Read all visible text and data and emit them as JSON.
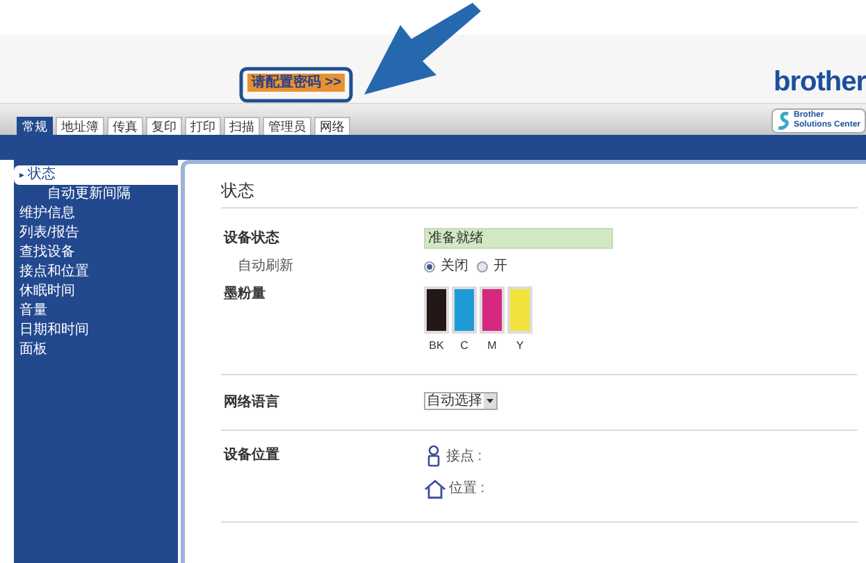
{
  "header": {
    "login_button": "请配置密码 >>",
    "logo": "brother",
    "solutions_button": {
      "line1": "Brother",
      "line2": "Solutions Center"
    }
  },
  "tabs": [
    {
      "label": "常规",
      "selected": true
    },
    {
      "label": "地址簿",
      "selected": false
    },
    {
      "label": "传真",
      "selected": false
    },
    {
      "label": "复印",
      "selected": false
    },
    {
      "label": "打印",
      "selected": false
    },
    {
      "label": "扫描",
      "selected": false
    },
    {
      "label": "管理员",
      "selected": false
    },
    {
      "label": "网络",
      "selected": false
    }
  ],
  "sidebar": {
    "items": [
      {
        "label": "状态",
        "marker": "▸",
        "selected": true,
        "children": [
          {
            "label": "自动更新间隔",
            "selected": false
          }
        ]
      },
      {
        "label": "维护信息",
        "selected": false
      },
      {
        "label": "列表/报告",
        "selected": false
      },
      {
        "label": "查找设备",
        "selected": false
      },
      {
        "label": "接点和位置",
        "selected": false
      },
      {
        "label": "休眠时间",
        "selected": false
      },
      {
        "label": "音量",
        "selected": false
      },
      {
        "label": "日期和时间",
        "selected": false
      },
      {
        "label": "面板",
        "selected": false
      }
    ]
  },
  "content": {
    "title": "状态",
    "device_status": {
      "label": "设备状态",
      "value": "准备就绪"
    },
    "auto_refresh": {
      "label": "自动刷新",
      "options": [
        {
          "label": "关闭",
          "selected": true
        },
        {
          "label": "开",
          "selected": false
        }
      ]
    },
    "toner": {
      "label": "墨粉量",
      "cartridges": [
        {
          "name": "BK",
          "color": "#231815",
          "level": 1
        },
        {
          "name": "C",
          "color": "#1e9bd7",
          "level": 1
        },
        {
          "name": "M",
          "color": "#d6287f",
          "level": 1
        },
        {
          "name": "Y",
          "color": "#f2e33c",
          "level": 1
        }
      ]
    },
    "web_language": {
      "label": "网络语言",
      "value": "自动选择"
    },
    "device_location": {
      "label": "设备位置",
      "contact": "接点 :",
      "location": "位置 :"
    }
  }
}
